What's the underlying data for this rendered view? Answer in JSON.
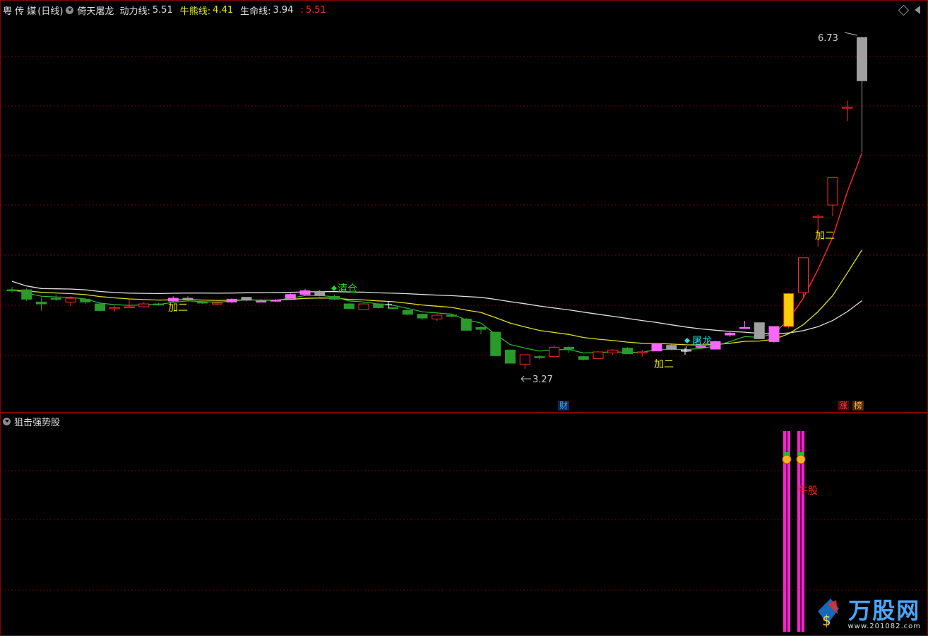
{
  "header": {
    "stock_name": "粤 传 媒",
    "period": "(日线)",
    "indicator_name": "倚天屠龙",
    "dongli_label": "动力线:",
    "dongli_value": "5.51",
    "niuxiong_label": "牛熊线:",
    "niuxiong_value": "4.41",
    "shengming_label": "生命线:",
    "shengming_value": "3.94",
    "extra_label": ":",
    "extra_value": "5.51"
  },
  "lower_panel": {
    "title": "狙击强势股",
    "signal_label": "牛股"
  },
  "markers": {
    "high_price": "6.73",
    "low_price": "3.27",
    "jiaer": "加二",
    "qingcang": "清仓",
    "tulong": "屠龙",
    "badge_cai": "财",
    "badge_zhang": "涨",
    "badge_bang": "榜"
  },
  "watermark": {
    "title": "万股网",
    "url": "www.201082.com"
  },
  "colors": {
    "up": "#ff2a2a",
    "down": "#2a9a2a",
    "magenta": "#ff66ff",
    "gray": "#a0a0a0",
    "yellow": "#e0e020",
    "white": "#e0e0e0",
    "grid": "#6a0000"
  },
  "chart_data": {
    "type": "candlestick",
    "price_axis": [
      3.0,
      7.0
    ],
    "overlays": [
      "动力线",
      "牛熊线",
      "生命线"
    ],
    "candles": [
      {
        "o": 4.05,
        "c": 4.05,
        "h": 4.08,
        "l": 4.02,
        "s": "down"
      },
      {
        "o": 4.05,
        "c": 3.95,
        "h": 4.07,
        "l": 3.93,
        "s": "down"
      },
      {
        "o": 3.9,
        "c": 3.92,
        "h": 3.97,
        "l": 3.83,
        "s": "down"
      },
      {
        "o": 3.96,
        "c": 3.96,
        "h": 4.0,
        "l": 3.93,
        "s": "down"
      },
      {
        "o": 3.92,
        "c": 3.96,
        "h": 3.98,
        "l": 3.88,
        "s": "up"
      },
      {
        "o": 3.95,
        "c": 3.92,
        "h": 3.96,
        "l": 3.9,
        "s": "down"
      },
      {
        "o": 3.9,
        "c": 3.83,
        "h": 3.91,
        "l": 3.82,
        "s": "down"
      },
      {
        "o": 3.85,
        "c": 3.86,
        "h": 3.88,
        "l": 3.82,
        "s": "up"
      },
      {
        "o": 3.86,
        "c": 3.87,
        "h": 3.95,
        "l": 3.86,
        "s": "up"
      },
      {
        "o": 3.87,
        "c": 3.9,
        "h": 3.92,
        "l": 3.86,
        "s": "up"
      },
      {
        "o": 3.9,
        "c": 3.9,
        "h": 3.91,
        "l": 3.88,
        "s": "down"
      },
      {
        "o": 3.93,
        "c": 3.96,
        "h": 3.98,
        "l": 3.92,
        "s": "mag"
      },
      {
        "o": 3.96,
        "c": 3.96,
        "h": 3.98,
        "l": 3.94,
        "s": "gray"
      },
      {
        "o": 3.92,
        "c": 3.91,
        "h": 3.93,
        "l": 3.9,
        "s": "down"
      },
      {
        "o": 3.9,
        "c": 3.91,
        "h": 3.93,
        "l": 3.89,
        "s": "up"
      },
      {
        "o": 3.92,
        "c": 3.95,
        "h": 3.96,
        "l": 3.91,
        "s": "mag"
      },
      {
        "o": 3.94,
        "c": 3.97,
        "h": 3.97,
        "l": 3.93,
        "s": "gray"
      },
      {
        "o": 3.93,
        "c": 3.93,
        "h": 3.95,
        "l": 3.92,
        "s": "mag"
      },
      {
        "o": 3.93,
        "c": 3.94,
        "h": 3.95,
        "l": 3.92,
        "s": "mag"
      },
      {
        "o": 3.96,
        "c": 4.0,
        "h": 4.01,
        "l": 3.95,
        "s": "mag"
      },
      {
        "o": 4.0,
        "c": 4.04,
        "h": 4.06,
        "l": 3.99,
        "s": "mag"
      },
      {
        "o": 4.03,
        "c": 3.99,
        "h": 4.05,
        "l": 3.98,
        "s": "gray"
      },
      {
        "o": 3.98,
        "c": 3.95,
        "h": 4.0,
        "l": 3.94,
        "s": "down"
      },
      {
        "o": 3.9,
        "c": 3.85,
        "h": 3.91,
        "l": 3.85,
        "s": "down"
      },
      {
        "o": 3.84,
        "c": 3.9,
        "h": 3.91,
        "l": 3.84,
        "s": "up"
      },
      {
        "o": 3.9,
        "c": 3.86,
        "h": 3.91,
        "l": 3.85,
        "s": "down"
      },
      {
        "o": 3.86,
        "c": 3.86,
        "h": 3.87,
        "l": 3.85,
        "s": "down"
      },
      {
        "o": 3.83,
        "c": 3.79,
        "h": 3.84,
        "l": 3.78,
        "s": "down"
      },
      {
        "o": 3.79,
        "c": 3.75,
        "h": 3.8,
        "l": 3.73,
        "s": "down"
      },
      {
        "o": 3.74,
        "c": 3.78,
        "h": 3.79,
        "l": 3.72,
        "s": "up"
      },
      {
        "o": 3.78,
        "c": 3.77,
        "h": 3.79,
        "l": 3.76,
        "s": "down"
      },
      {
        "o": 3.74,
        "c": 3.62,
        "h": 3.75,
        "l": 3.62,
        "s": "down"
      },
      {
        "o": 3.65,
        "c": 3.63,
        "h": 3.66,
        "l": 3.58,
        "s": "down"
      },
      {
        "o": 3.6,
        "c": 3.35,
        "h": 3.6,
        "l": 3.35,
        "s": "down"
      },
      {
        "o": 3.41,
        "c": 3.27,
        "h": 3.41,
        "l": 3.27,
        "s": "down"
      },
      {
        "o": 3.26,
        "c": 3.36,
        "h": 3.36,
        "l": 3.21,
        "s": "up"
      },
      {
        "o": 3.34,
        "c": 3.34,
        "h": 3.36,
        "l": 3.31,
        "s": "down"
      },
      {
        "o": 3.34,
        "c": 3.44,
        "h": 3.46,
        "l": 3.33,
        "s": "up"
      },
      {
        "o": 3.44,
        "c": 3.42,
        "h": 3.45,
        "l": 3.38,
        "s": "down"
      },
      {
        "o": 3.34,
        "c": 3.31,
        "h": 3.35,
        "l": 3.3,
        "s": "down"
      },
      {
        "o": 3.32,
        "c": 3.39,
        "h": 3.4,
        "l": 3.32,
        "s": "up"
      },
      {
        "o": 3.38,
        "c": 3.41,
        "h": 3.42,
        "l": 3.36,
        "s": "up"
      },
      {
        "o": 3.43,
        "c": 3.37,
        "h": 3.44,
        "l": 3.37,
        "s": "down"
      },
      {
        "o": 3.39,
        "c": 3.39,
        "h": 3.41,
        "l": 3.34,
        "s": "up"
      },
      {
        "o": 3.4,
        "c": 3.47,
        "h": 3.47,
        "l": 3.4,
        "s": "mag"
      },
      {
        "o": 3.46,
        "c": 3.42,
        "h": 3.47,
        "l": 3.41,
        "s": "gray"
      },
      {
        "o": 3.41,
        "c": 3.41,
        "h": 3.45,
        "l": 3.39,
        "s": "white"
      },
      {
        "o": 3.45,
        "c": 3.45,
        "h": 3.47,
        "l": 3.43,
        "s": "mag"
      },
      {
        "o": 3.42,
        "c": 3.5,
        "h": 3.51,
        "l": 3.42,
        "s": "mag"
      },
      {
        "o": 3.57,
        "c": 3.59,
        "h": 3.6,
        "l": 3.55,
        "s": "mag"
      },
      {
        "o": 3.64,
        "c": 3.65,
        "h": 3.72,
        "l": 3.64,
        "s": "mag"
      },
      {
        "o": 3.7,
        "c": 3.53,
        "h": 3.7,
        "l": 3.53,
        "s": "gray"
      },
      {
        "o": 3.5,
        "c": 3.66,
        "h": 3.66,
        "l": 3.49,
        "s": "mag"
      },
      {
        "o": 3.66,
        "c": 4.01,
        "h": 4.02,
        "l": 3.64,
        "s": "yel"
      },
      {
        "o": 4.02,
        "c": 4.39,
        "h": 4.39,
        "l": 3.97,
        "s": "up"
      },
      {
        "o": 4.83,
        "c": 4.83,
        "h": 4.85,
        "l": 4.51,
        "s": "up"
      },
      {
        "o": 4.95,
        "c": 5.24,
        "h": 5.24,
        "l": 4.83,
        "s": "up"
      },
      {
        "o": 5.99,
        "c": 5.99,
        "h": 6.06,
        "l": 5.84,
        "s": "up"
      },
      {
        "o": 6.73,
        "c": 6.27,
        "h": 6.73,
        "l": 5.51,
        "s": "gray"
      }
    ]
  }
}
